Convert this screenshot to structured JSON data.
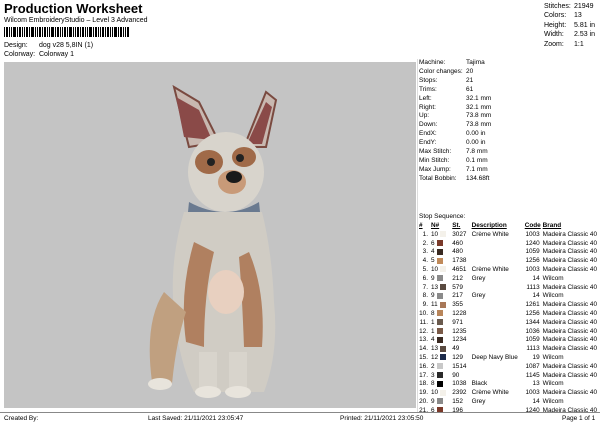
{
  "header": {
    "title": "Production Worksheet",
    "subtitle": "Wilcom EmbroideryStudio – Level 3 Advanced",
    "design_label": "Design:",
    "design_value": "dog v28 5,8IN (1)",
    "colorway_label": "Colorway:",
    "colorway_value": "Colorway 1"
  },
  "stats": [
    {
      "label": "Stitches:",
      "value": "21949"
    },
    {
      "label": "Colors:",
      "value": "13"
    },
    {
      "label": "Height:",
      "value": "5.81 in"
    },
    {
      "label": "Width:",
      "value": "2.53 in"
    },
    {
      "label": "Zoom:",
      "value": "1:1"
    }
  ],
  "info": [
    {
      "label": "Machine:",
      "value": "Tajima"
    },
    {
      "label": "Color changes:",
      "value": "20"
    },
    {
      "label": "Stops:",
      "value": "21"
    },
    {
      "label": "Trims:",
      "value": "61"
    },
    {
      "label": "Left:",
      "value": "32.1 mm"
    },
    {
      "label": "Right:",
      "value": "32.1 mm"
    },
    {
      "label": "Up:",
      "value": "73.8 mm"
    },
    {
      "label": "Down:",
      "value": "73.8 mm"
    },
    {
      "label": "EndX:",
      "value": "0.00 in"
    },
    {
      "label": "EndY:",
      "value": "0.00 in"
    },
    {
      "label": "Max Stitch:",
      "value": "7.8 mm"
    },
    {
      "label": "Min Stitch:",
      "value": "0.1 mm"
    },
    {
      "label": "Max Jump:",
      "value": "7.1 mm"
    },
    {
      "label": "Total Bobbin:",
      "value": "134.68ft"
    }
  ],
  "sequence": {
    "title": "Stop Sequence:",
    "headers": [
      "#",
      "N#",
      "St.",
      "Description",
      "Code",
      "Brand"
    ],
    "rows": [
      {
        "n": "1.",
        "nn": "10",
        "st": "3027",
        "desc": "Crème White",
        "code": "1003",
        "brand": "Madeira Classic 40",
        "color": "#f4f1ea"
      },
      {
        "n": "2.",
        "nn": "6",
        "st": "460",
        "desc": "",
        "code": "1240",
        "brand": "Madeira Classic 40",
        "color": "#7a3a2a"
      },
      {
        "n": "3.",
        "nn": "4",
        "st": "480",
        "desc": "",
        "code": "1059",
        "brand": "Madeira Classic 40",
        "color": "#3a2a22"
      },
      {
        "n": "4.",
        "nn": "5",
        "st": "1738",
        "desc": "",
        "code": "1256",
        "brand": "Madeira Classic 40",
        "color": "#c08a5a"
      },
      {
        "n": "5.",
        "nn": "10",
        "st": "4651",
        "desc": "Crème White",
        "code": "1003",
        "brand": "Madeira Classic 40",
        "color": "#f4f1ea"
      },
      {
        "n": "6.",
        "nn": "9",
        "st": "212",
        "desc": "Grey",
        "code": "14",
        "brand": "Wilcom",
        "color": "#8a8a8a"
      },
      {
        "n": "7.",
        "nn": "13",
        "st": "579",
        "desc": "",
        "code": "1113",
        "brand": "Madeira Classic 40",
        "color": "#5a4a40"
      },
      {
        "n": "8.",
        "nn": "9",
        "st": "217",
        "desc": "Grey",
        "code": "14",
        "brand": "Wilcom",
        "color": "#8a8a8a"
      },
      {
        "n": "9.",
        "nn": "11",
        "st": "355",
        "desc": "",
        "code": "1261",
        "brand": "Madeira Classic 40",
        "color": "#a87858"
      },
      {
        "n": "10.",
        "nn": "8",
        "st": "1228",
        "desc": "",
        "code": "1256",
        "brand": "Madeira Classic 40",
        "color": "#b8855a"
      },
      {
        "n": "11.",
        "nn": "1",
        "st": "971",
        "desc": "",
        "code": "1344",
        "brand": "Madeira Classic 40",
        "color": "#6a5a4e"
      },
      {
        "n": "12.",
        "nn": "1",
        "st": "1235",
        "desc": "",
        "code": "1036",
        "brand": "Madeira Classic 40",
        "color": "#7a5a48"
      },
      {
        "n": "13.",
        "nn": "4",
        "st": "1234",
        "desc": "",
        "code": "1059",
        "brand": "Madeira Classic 40",
        "color": "#3a2a22"
      },
      {
        "n": "14.",
        "nn": "13",
        "st": "49",
        "desc": "",
        "code": "1113",
        "brand": "Madeira Classic 40",
        "color": "#5a4a40"
      },
      {
        "n": "15.",
        "nn": "12",
        "st": "129",
        "desc": "Deep Navy Blue",
        "code": "19",
        "brand": "Wilcom",
        "color": "#1c2a4a"
      },
      {
        "n": "16.",
        "nn": "2",
        "st": "1514",
        "desc": "",
        "code": "1087",
        "brand": "Madeira Classic 40",
        "color": "#c8c8c8"
      },
      {
        "n": "17.",
        "nn": "3",
        "st": "90",
        "desc": "",
        "code": "1145",
        "brand": "Madeira Classic 40",
        "color": "#2a2a2a"
      },
      {
        "n": "18.",
        "nn": "8",
        "st": "1038",
        "desc": "Black",
        "code": "13",
        "brand": "Wilcom",
        "color": "#000000"
      },
      {
        "n": "19.",
        "nn": "10",
        "st": "2392",
        "desc": "Crème White",
        "code": "1003",
        "brand": "Madeira Classic 40",
        "color": "#f4f1ea"
      },
      {
        "n": "20.",
        "nn": "9",
        "st": "152",
        "desc": "Grey",
        "code": "14",
        "brand": "Wilcom",
        "color": "#8a8a8a"
      },
      {
        "n": "21.",
        "nn": "6",
        "st": "196",
        "desc": "",
        "code": "1240",
        "brand": "Madeira Classic 40",
        "color": "#7a3a2a"
      }
    ]
  },
  "footer": {
    "created_by": "Created By:",
    "last_saved": "Last Saved: 21/11/2021 23:05:47",
    "printed": "Printed: 21/11/2021 23:05:50",
    "page": "Page 1 of 1"
  },
  "preview": {
    "background": "#c4c4c4"
  }
}
